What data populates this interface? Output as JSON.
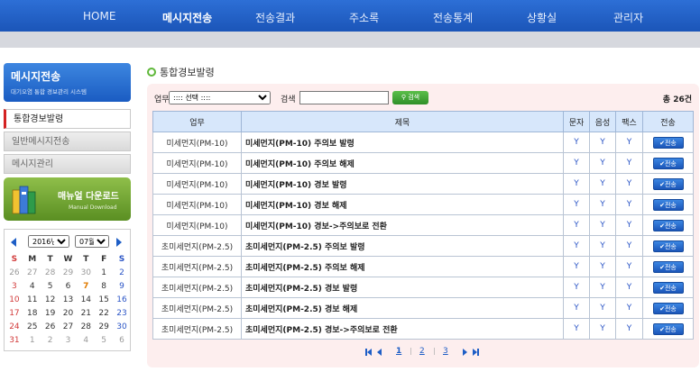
{
  "nav": {
    "items": [
      "HOME",
      "메시지전송",
      "전송결과",
      "주소록",
      "전송통계",
      "상황실",
      "관리자"
    ],
    "active_index": 1
  },
  "sidebar": {
    "title": "메시지전송",
    "subtitle": "대기오염 통합 경보관리 시스템",
    "menu": [
      "통합경보발령",
      "일반메시지전송",
      "메시지관리"
    ],
    "active_menu": 0
  },
  "manual": {
    "label": "매뉴얼 다운로드",
    "sublabel": "Manual Download"
  },
  "calendar": {
    "year": "2016년",
    "month": "07월",
    "weekdays": [
      "S",
      "M",
      "T",
      "W",
      "T",
      "F",
      "S"
    ],
    "weeks": [
      [
        "26",
        "27",
        "28",
        "29",
        "30",
        "1",
        "2"
      ],
      [
        "3",
        "4",
        "5",
        "6",
        "7",
        "8",
        "9"
      ],
      [
        "10",
        "11",
        "12",
        "13",
        "14",
        "15",
        "16"
      ],
      [
        "17",
        "18",
        "19",
        "20",
        "21",
        "22",
        "23"
      ],
      [
        "24",
        "25",
        "26",
        "27",
        "28",
        "29",
        "30"
      ],
      [
        "31",
        "1",
        "2",
        "3",
        "4",
        "5",
        "6"
      ]
    ],
    "today": "7"
  },
  "page": {
    "title": "통합경보발령"
  },
  "filters": {
    "category_label": "업무",
    "category_value": ":::: 선택 ::::",
    "search_label": "검색",
    "search_value": "",
    "search_button": "검색",
    "total": "총 26건"
  },
  "table": {
    "headers": [
      "업무",
      "제목",
      "문자",
      "음성",
      "팩스",
      "전송"
    ],
    "send_label": "전송",
    "rows": [
      {
        "category": "미세먼지(PM-10)",
        "title": "미세먼지(PM-10) 주의보 발령",
        "sms": "Y",
        "voice": "Y",
        "fax": "Y"
      },
      {
        "category": "미세먼지(PM-10)",
        "title": "미세먼지(PM-10) 주의보 해제",
        "sms": "Y",
        "voice": "Y",
        "fax": "Y"
      },
      {
        "category": "미세먼지(PM-10)",
        "title": "미세먼지(PM-10) 경보 발령",
        "sms": "Y",
        "voice": "Y",
        "fax": "Y"
      },
      {
        "category": "미세먼지(PM-10)",
        "title": "미세먼지(PM-10) 경보 해제",
        "sms": "Y",
        "voice": "Y",
        "fax": "Y"
      },
      {
        "category": "미세먼지(PM-10)",
        "title": "미세먼지(PM-10) 경보->주의보로 전환",
        "sms": "Y",
        "voice": "Y",
        "fax": "Y"
      },
      {
        "category": "초미세먼지(PM-2.5)",
        "title": "초미세먼지(PM-2.5) 주의보 발령",
        "sms": "Y",
        "voice": "Y",
        "fax": "Y"
      },
      {
        "category": "초미세먼지(PM-2.5)",
        "title": "초미세먼지(PM-2.5) 주의보 해제",
        "sms": "Y",
        "voice": "Y",
        "fax": "Y"
      },
      {
        "category": "초미세먼지(PM-2.5)",
        "title": "초미세먼지(PM-2.5) 경보 발령",
        "sms": "Y",
        "voice": "Y",
        "fax": "Y"
      },
      {
        "category": "초미세먼지(PM-2.5)",
        "title": "초미세먼지(PM-2.5) 경보 해제",
        "sms": "Y",
        "voice": "Y",
        "fax": "Y"
      },
      {
        "category": "초미세먼지(PM-2.5)",
        "title": "초미세먼지(PM-2.5) 경보->주의보로 전환",
        "sms": "Y",
        "voice": "Y",
        "fax": "Y"
      }
    ]
  },
  "pagination": {
    "pages": [
      "1",
      "2",
      "3"
    ],
    "current": "1"
  },
  "colors": {
    "nav": "#1b55b8",
    "accent_green": "#5fb83a",
    "panel_bg": "#fdeeee",
    "header_bg": "#d7e7fb",
    "active_bar": "#d42222"
  }
}
